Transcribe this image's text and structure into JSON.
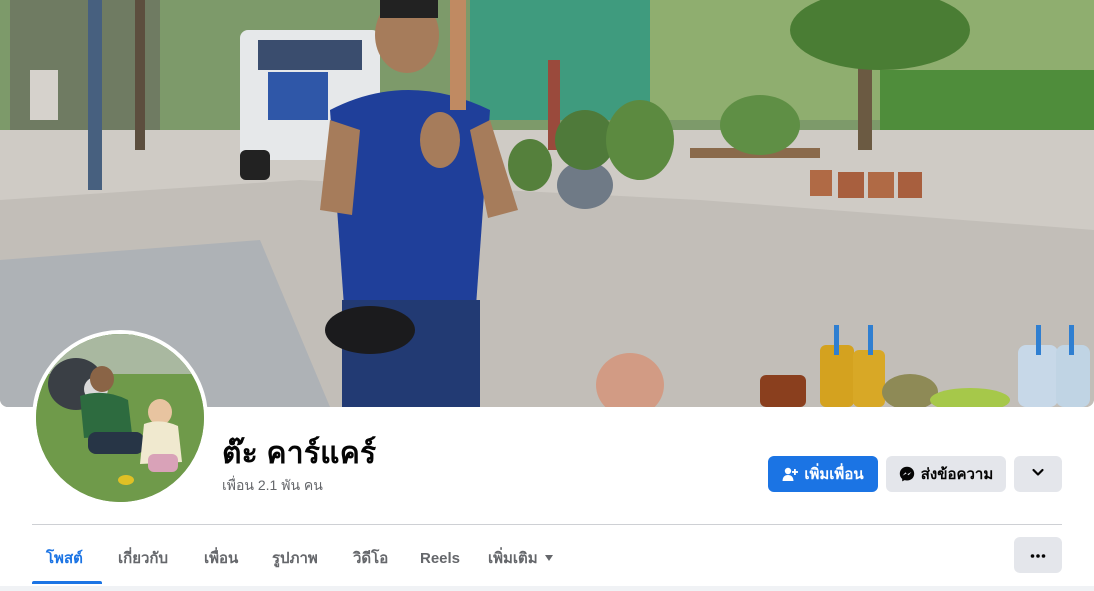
{
  "profile": {
    "name": "ต๊ะ คาร์แคร์",
    "friends_count": "เพื่อน 2.1 พัน คน"
  },
  "actions": {
    "add_friend": {
      "label": "เพิ่มเพื่อน",
      "icon": "add-friend-icon"
    },
    "message": {
      "label": "ส่งข้อความ",
      "icon": "messenger-icon"
    },
    "more": {
      "icon": "chevron-down-icon"
    }
  },
  "tabs": [
    {
      "label": "โพสต์",
      "active": true
    },
    {
      "label": "เกี่ยวกับ",
      "active": false
    },
    {
      "label": "เพื่อน",
      "active": false
    },
    {
      "label": "รูปภาพ",
      "active": false
    },
    {
      "label": "วิดีโอ",
      "active": false
    },
    {
      "label": "Reels",
      "active": false
    },
    {
      "label": "เพิ่มเติม",
      "active": false,
      "dropdown": true
    }
  ],
  "tab_overflow": {
    "icon": "more-dots-icon"
  },
  "colors": {
    "accent": "#1b74e4",
    "button_secondary": "#e4e6eb",
    "muted_text": "#65676b",
    "divider": "#ced0d4"
  }
}
